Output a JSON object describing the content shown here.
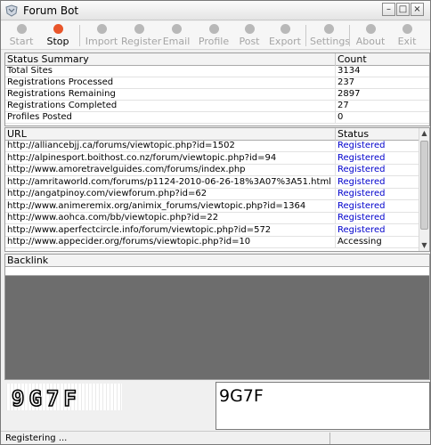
{
  "window": {
    "title": "Forum Bot"
  },
  "toolbar": [
    {
      "name": "start",
      "label": "Start",
      "enabled": false
    },
    {
      "name": "stop",
      "label": "Stop",
      "enabled": true
    },
    {
      "name": "import",
      "label": "Import",
      "enabled": false
    },
    {
      "name": "register",
      "label": "Register",
      "enabled": false
    },
    {
      "name": "email",
      "label": "Email",
      "enabled": false
    },
    {
      "name": "profile",
      "label": "Profile",
      "enabled": false
    },
    {
      "name": "post",
      "label": "Post",
      "enabled": false
    },
    {
      "name": "export",
      "label": "Export",
      "enabled": false
    },
    {
      "name": "settings",
      "label": "Settings",
      "enabled": false
    },
    {
      "name": "about",
      "label": "About",
      "enabled": false
    },
    {
      "name": "exit",
      "label": "Exit",
      "enabled": false
    }
  ],
  "summary": {
    "headers": [
      "Status Summary",
      "Count"
    ],
    "rows": [
      [
        "Total Sites",
        "3134"
      ],
      [
        "Registrations Processed",
        "237"
      ],
      [
        "Registrations Remaining",
        "2897"
      ],
      [
        "Registrations Completed",
        "27"
      ],
      [
        "Profiles Posted",
        "0"
      ]
    ]
  },
  "urls": {
    "headers": [
      "URL",
      "Status"
    ],
    "rows": [
      [
        "http://alliancebjj.ca/forums/viewtopic.php?id=1502",
        "Registered"
      ],
      [
        "http://alpinesport.boithost.co.nz/forum/viewtopic.php?id=94",
        "Registered"
      ],
      [
        "http://www.amoretravelguides.com/forums/index.php",
        "Registered"
      ],
      [
        "http://amritaworld.com/forums/p1124-2010-06-26-18%3A07%3A51.html",
        "Registered"
      ],
      [
        "http://angatpinoy.com/viewforum.php?id=62",
        "Registered"
      ],
      [
        "http://www.animeremix.org/animix_forums/viewtopic.php?id=1364",
        "Registered"
      ],
      [
        "http://www.aohca.com/bb/viewtopic.php?id=22",
        "Registered"
      ],
      [
        "http://www.aperfectcircle.info/forum/viewtopic.php?id=572",
        "Registered"
      ],
      [
        "http://www.appecider.org/forums/viewtopic.php?id=10",
        "Accessing"
      ]
    ]
  },
  "backlink": {
    "header": "Backlink",
    "value": ""
  },
  "captcha": {
    "image_text": "9G7F",
    "input_value": "9G7F"
  },
  "statusbar": {
    "text": "Registering ..."
  }
}
